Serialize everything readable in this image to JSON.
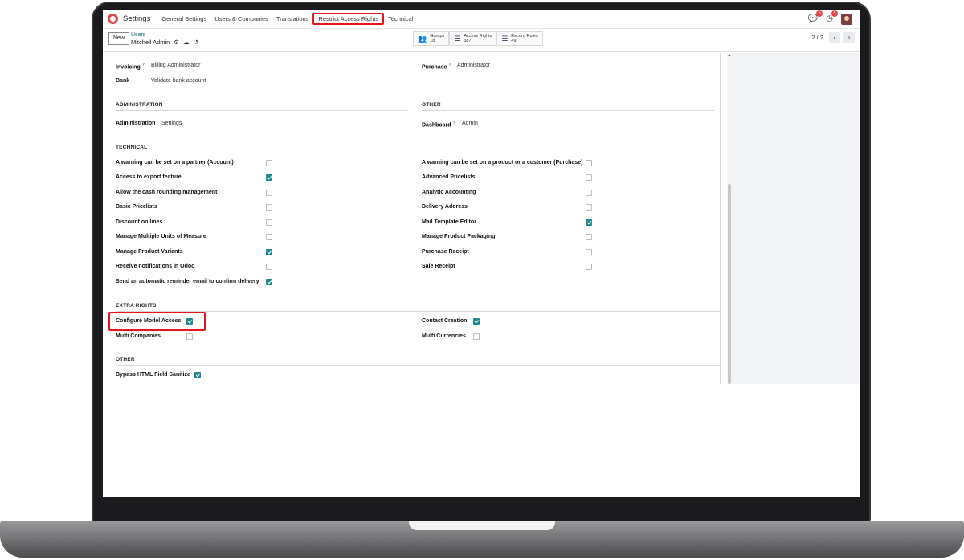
{
  "navbar": {
    "app_title": "Settings",
    "menu": [
      "General Settings",
      "Users & Companies",
      "Translations",
      "Restrict Access Rights",
      "Technical"
    ],
    "messages_badge": "5",
    "activity_badge": "5"
  },
  "control": {
    "new_label": "New",
    "breadcrumb_parent": "Users",
    "breadcrumb_current": "Mitchell Admin",
    "pager": "2 / 2",
    "smart_buttons": [
      {
        "label": "Groups",
        "value": "18",
        "icon": "users-icon"
      },
      {
        "label": "Access Rights",
        "value": "387",
        "icon": "list-icon"
      },
      {
        "label": "Record Rules",
        "value": "49",
        "icon": "list-icon"
      }
    ]
  },
  "form": {
    "top_fields_left": [
      {
        "label": "Invoicing",
        "value": "Billing Administrator",
        "help": "?"
      },
      {
        "label": "Bank",
        "value": "Validate bank account"
      }
    ],
    "top_fields_right": [
      {
        "label": "Purchase",
        "value": "Administrator",
        "help": "?"
      }
    ],
    "administration": {
      "title": "ADMINISTRATION",
      "label": "Administration",
      "value": "Settings"
    },
    "other_top": {
      "title": "OTHER",
      "label": "Dashboard",
      "value": "Admin",
      "help": "?"
    },
    "technical": {
      "title": "TECHNICAL",
      "left": [
        {
          "label": "A warning can be set on a partner (Account)",
          "checked": false
        },
        {
          "label": "Access to export feature",
          "checked": true
        },
        {
          "label": "Allow the cash rounding management",
          "checked": false
        },
        {
          "label": "Basic Pricelists",
          "checked": false
        },
        {
          "label": "Discount on lines",
          "checked": false
        },
        {
          "label": "Manage Multiple Units of Measure",
          "checked": false
        },
        {
          "label": "Manage Product Variants",
          "checked": true
        },
        {
          "label": "Receive notifications in Odoo",
          "checked": false
        },
        {
          "label": "Send an automatic reminder email to confirm delivery",
          "checked": true
        }
      ],
      "right": [
        {
          "label": "A warning can be set on a product or a customer (Purchase)",
          "checked": false
        },
        {
          "label": "Advanced Pricelists",
          "checked": false
        },
        {
          "label": "Analytic Accounting",
          "checked": false
        },
        {
          "label": "Delivery Address",
          "checked": false
        },
        {
          "label": "Mail Template Editor",
          "checked": true
        },
        {
          "label": "Manage Product Packaging",
          "checked": false
        },
        {
          "label": "Purchase Receipt",
          "checked": false
        },
        {
          "label": "Sale Receipt",
          "checked": false
        }
      ]
    },
    "extra_rights": {
      "title": "EXTRA RIGHTS",
      "left": [
        {
          "label": "Configure Model Access",
          "checked": true
        },
        {
          "label": "Multi Companies",
          "checked": false
        }
      ],
      "right": [
        {
          "label": "Contact Creation",
          "checked": true
        },
        {
          "label": "Multi Currencies",
          "checked": false
        }
      ]
    },
    "other_bottom": {
      "title": "OTHER",
      "items": [
        {
          "label": "Bypass HTML Field Sanitize",
          "checked": true
        }
      ]
    }
  },
  "colors": {
    "accent": "#1f8a8f",
    "highlight": "#e8141b",
    "brand": "#e0474c"
  }
}
